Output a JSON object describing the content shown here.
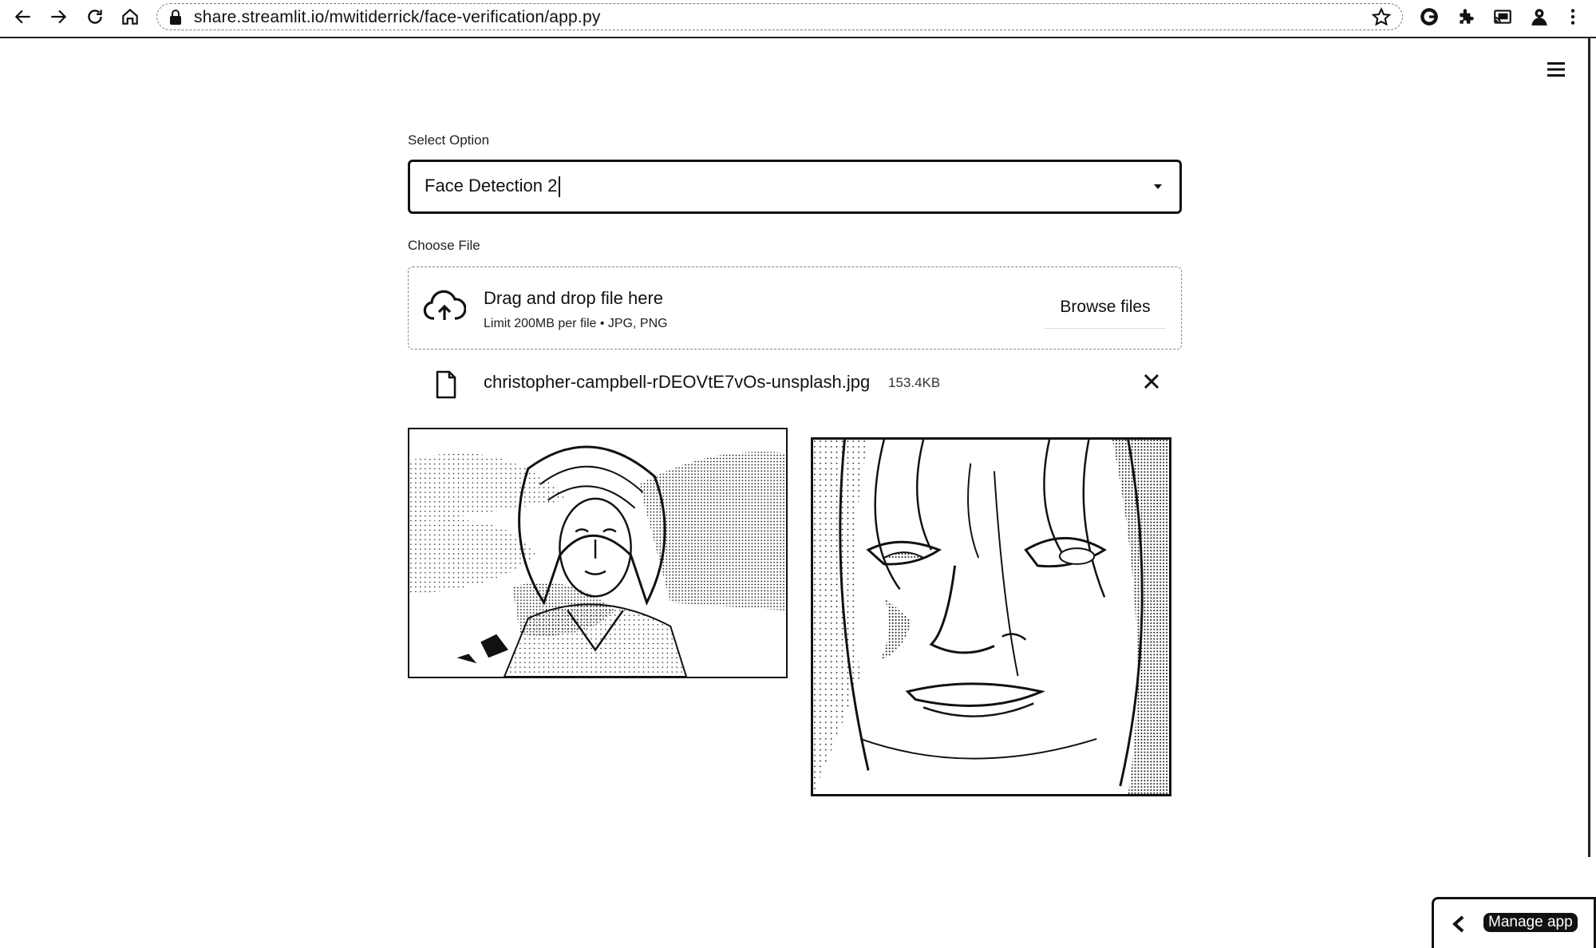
{
  "browser": {
    "url": "share.streamlit.io/mwitiderrick/face-verification/app.py",
    "icons": [
      "back-icon",
      "forward-icon",
      "reload-icon",
      "home-icon",
      "lock-icon",
      "star-icon",
      "extension-g-icon",
      "extensions-puzzle-icon",
      "cast-icon",
      "profile-icon",
      "more-icon"
    ]
  },
  "app": {
    "menu_icon": "hamburger-menu-icon",
    "select": {
      "label": "Select Option",
      "value": "Face Detection 2"
    },
    "uploader": {
      "label": "Choose File",
      "title": "Drag and drop file here",
      "subtitle": "Limit 200MB per file • JPG, PNG",
      "browse_label": "Browse files"
    },
    "uploaded_file": {
      "name": "christopher-campbell-rDEOVtE7vOs-unsplash.jpg",
      "size": "153.4KB"
    },
    "manage_app_label": "Manage app"
  },
  "colors": {
    "ink": "#111111",
    "background": "#ffffff"
  }
}
